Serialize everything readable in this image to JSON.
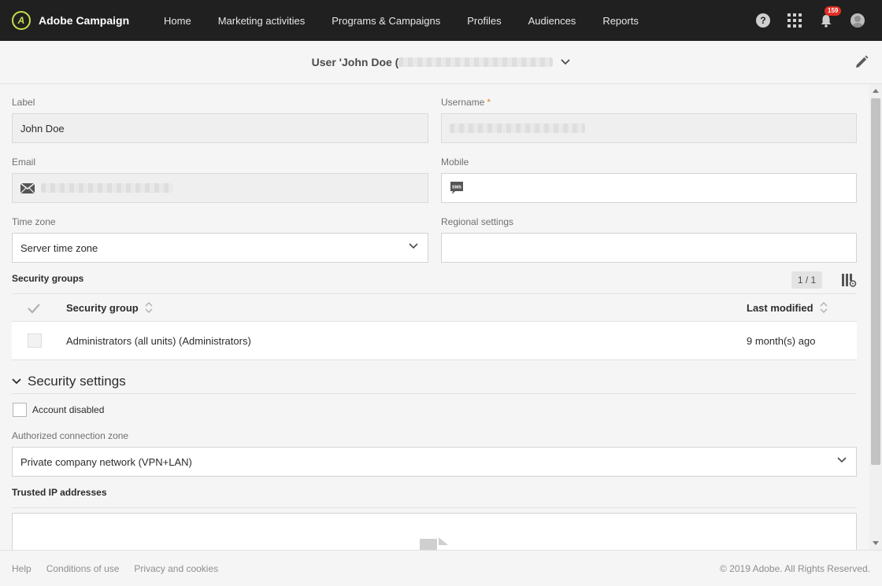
{
  "app": {
    "name": "Adobe Campaign",
    "logo_letter": "A"
  },
  "nav": {
    "items": [
      "Home",
      "Marketing activities",
      "Programs & Campaigns",
      "Profiles",
      "Audiences",
      "Reports"
    ],
    "help_glyph": "?",
    "notification_count": "159"
  },
  "header": {
    "title_prefix": "User 'John Doe ("
  },
  "form": {
    "label": {
      "label": "Label",
      "value": "John Doe"
    },
    "username": {
      "label": "Username",
      "required_mark": "*"
    },
    "email": {
      "label": "Email"
    },
    "mobile": {
      "label": "Mobile",
      "icon_text": "SMS",
      "value": ""
    },
    "time_zone": {
      "label": "Time zone",
      "value": "Server time zone"
    },
    "regional_settings": {
      "label": "Regional settings",
      "value": ""
    }
  },
  "security_groups": {
    "title": "Security groups",
    "pager": "1 / 1",
    "columns": {
      "group": "Security group",
      "modified": "Last modified"
    },
    "rows": [
      {
        "group": "Administrators (all units) (Administrators)",
        "modified": "9 month(s) ago"
      }
    ]
  },
  "security_settings": {
    "title": "Security settings",
    "account_disabled": "Account disabled",
    "zone_label": "Authorized connection zone",
    "zone_value": "Private company network (VPN+LAN)",
    "trusted_ip_title": "Trusted IP addresses"
  },
  "footer": {
    "links": [
      "Help",
      "Conditions of use",
      "Privacy and cookies"
    ],
    "copyright": "© 2019 Adobe. All Rights Reserved."
  },
  "colors": {
    "topbar": "#202020",
    "accent_logo": "#c8e04a",
    "badge": "#e22d24",
    "required": "#e68619"
  }
}
